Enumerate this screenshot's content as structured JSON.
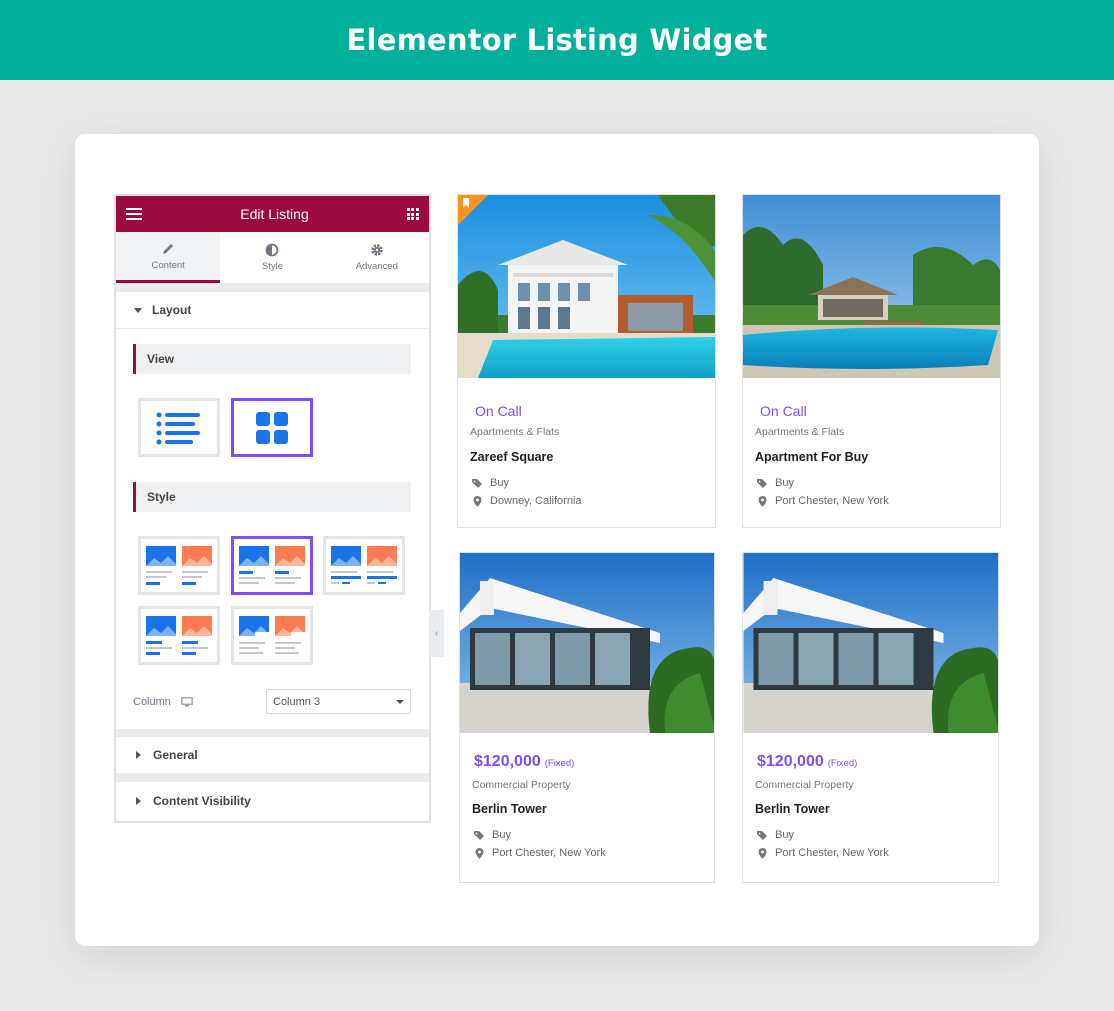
{
  "banner": {
    "title": "Elementor Listing Widget"
  },
  "panel": {
    "header_title": "Edit Listing",
    "tabs": [
      {
        "label": "Content",
        "icon": "pencil-icon"
      },
      {
        "label": "Style",
        "icon": "half-circle-icon"
      },
      {
        "label": "Advanced",
        "icon": "gear-icon"
      }
    ],
    "layout_label": "Layout",
    "view_label": "View",
    "style_label": "Style",
    "column_label": "Column",
    "column_value": "Column 3",
    "general_label": "General",
    "content_visibility_label": "Content Visibility"
  },
  "listings": [
    {
      "status": "On Call",
      "category": "Apartments & Flats",
      "title": "Zareef Square",
      "type": "Buy",
      "location": "Downey, California",
      "featured": true
    },
    {
      "status": "On Call",
      "category": "Apartments & Flats",
      "title": "Apartment For Buy",
      "type": "Buy",
      "location": "Port Chester, New York",
      "featured": false
    },
    {
      "price": "$120,000",
      "price_note": "(Fixed)",
      "category": "Commercial Property",
      "title": "Berlin Tower",
      "type": "Buy",
      "location": "Port Chester, New York"
    },
    {
      "price": "$120,000",
      "price_note": "(Fixed)",
      "category": "Commercial Property",
      "title": "Berlin Tower",
      "type": "Buy",
      "location": "Port Chester, New York"
    }
  ],
  "colors": {
    "banner": "#00b09b",
    "panel_header": "#9b0a3e",
    "accent": "#7b4dff",
    "ribbon": "#f7941d"
  }
}
